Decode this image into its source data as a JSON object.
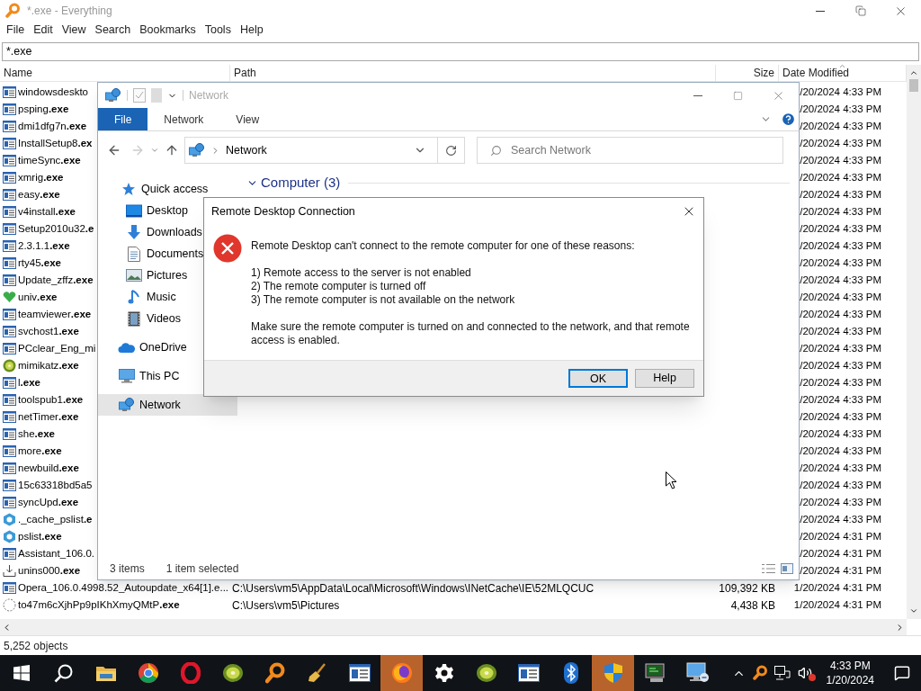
{
  "everything": {
    "title": "*.exe - Everything",
    "menu": [
      "File",
      "Edit",
      "View",
      "Search",
      "Bookmarks",
      "Tools",
      "Help"
    ],
    "search": {
      "value": "*.exe"
    },
    "columns": [
      {
        "label": "Name",
        "sorted": false
      },
      {
        "label": "Path",
        "sorted": false
      },
      {
        "label": "Size",
        "sorted": false
      },
      {
        "label": "Date Modified",
        "sorted": true
      }
    ],
    "rows": [
      {
        "kind": "app",
        "name": "windowsdeskto",
        "date": "/20/2024 4:33 PM"
      },
      {
        "kind": "app",
        "name": "psping**.exe**",
        "date": "/20/2024 4:33 PM"
      },
      {
        "kind": "app",
        "name": "dmi1dfg7n**.exe**",
        "date": "/20/2024 4:33 PM"
      },
      {
        "kind": "app",
        "name": "InstallSetup8**.ex**",
        "date": "/20/2024 4:33 PM"
      },
      {
        "kind": "app",
        "name": "timeSync**.exe**",
        "date": "/20/2024 4:33 PM"
      },
      {
        "kind": "app",
        "name": "xmrig**.exe**",
        "date": "/20/2024 4:33 PM"
      },
      {
        "kind": "app",
        "name": "easy**.exe**",
        "date": "/20/2024 4:33 PM"
      },
      {
        "kind": "app",
        "name": "v4install**.exe**",
        "date": "/20/2024 4:33 PM"
      },
      {
        "kind": "app",
        "name": "Setup2010u32**.e**",
        "date": "/20/2024 4:33 PM"
      },
      {
        "kind": "app",
        "name": "2.3.1.1**.exe**",
        "date": "/20/2024 4:33 PM"
      },
      {
        "kind": "app",
        "name": "rty45**.exe**",
        "date": "/20/2024 4:33 PM"
      },
      {
        "kind": "app",
        "name": "Update_zffz**.exe**",
        "date": "/20/2024 4:33 PM"
      },
      {
        "kind": "heart",
        "name": "univ**.exe**",
        "date": "/20/2024 4:33 PM"
      },
      {
        "kind": "app",
        "name": "teamviewer**.exe**",
        "date": "/20/2024 4:33 PM"
      },
      {
        "kind": "app",
        "name": "svchost1**.exe**",
        "date": "/20/2024 4:33 PM"
      },
      {
        "kind": "app",
        "name": "PCclear_Eng_mi",
        "date": "/20/2024 4:33 PM"
      },
      {
        "kind": "kiwi",
        "name": "mimikatz**.exe**",
        "date": "/20/2024 4:33 PM"
      },
      {
        "kind": "app",
        "name": "l**.exe**",
        "date": "/20/2024 4:33 PM"
      },
      {
        "kind": "app",
        "name": "toolspub1**.exe**",
        "date": "/20/2024 4:33 PM"
      },
      {
        "kind": "app",
        "name": "netTimer**.exe**",
        "date": "/20/2024 4:33 PM"
      },
      {
        "kind": "app",
        "name": "she**.exe**",
        "date": "/20/2024 4:33 PM"
      },
      {
        "kind": "app",
        "name": "more**.exe**",
        "date": "/20/2024 4:33 PM"
      },
      {
        "kind": "app",
        "name": "newbuild**.exe**",
        "date": "/20/2024 4:33 PM"
      },
      {
        "kind": "app",
        "name": "15c63318bd5a5",
        "date": "/20/2024 4:33 PM"
      },
      {
        "kind": "app",
        "name": "syncUpd**.exe**",
        "date": "/20/2024 4:33 PM"
      },
      {
        "kind": "hexagon",
        "name": "._cache_pslist**.e**",
        "date": "/20/2024 4:33 PM"
      },
      {
        "kind": "hexagon",
        "name": "pslist**.exe**",
        "date": "/20/2024 4:31 PM"
      },
      {
        "kind": "app",
        "name": "Assistant_106.0.",
        "date": "/20/2024 4:31 PM"
      },
      {
        "kind": "setup",
        "name": "unins000**.exe**",
        "date": "/20/2024 4:31 PM"
      },
      {
        "kind": "app",
        "name": "Opera_106.0.4998.52_Autoupdate_x64[1].e...",
        "path": "C:\\Users\\vm5\\AppData\\Local\\Microsoft\\Windows\\INetCache\\IE\\52MLQCUC",
        "size": "109,392 KB",
        "date": "1/20/2024 4:31 PM"
      },
      {
        "kind": "blank",
        "name": "to47m6cXjhPp9pIKhXmyQMtP**.exe**",
        "path": "C:\\Users\\vm5\\Pictures",
        "size": "4,438 KB",
        "date": "1/20/2024 4:31 PM"
      }
    ],
    "status": "5,252 objects"
  },
  "explorer": {
    "title": "Network",
    "tabs": [
      {
        "label": "File",
        "selected": true
      },
      {
        "label": "Network",
        "selected": false
      },
      {
        "label": "View",
        "selected": false
      }
    ],
    "address": "Network",
    "search": {
      "placeholder": "Search Network"
    },
    "nav": [
      {
        "kind": "star",
        "label": "Quick access",
        "selected": false
      },
      {
        "kind": "desktop",
        "label": "Desktop",
        "selected": false
      },
      {
        "kind": "downloads",
        "label": "Downloads",
        "selected": false
      },
      {
        "kind": "documents",
        "label": "Documents",
        "selected": false
      },
      {
        "kind": "pictures",
        "label": "Pictures",
        "selected": false
      },
      {
        "kind": "music",
        "label": "Music",
        "selected": false
      },
      {
        "kind": "videos",
        "label": "Videos",
        "selected": false
      },
      {
        "kind": "cloud",
        "label": "OneDrive",
        "selected": false
      },
      {
        "kind": "pc",
        "label": "This PC",
        "selected": false
      },
      {
        "kind": "network",
        "label": "Network",
        "selected": true
      }
    ],
    "group": "Computer (3)",
    "status": {
      "count": "3 items",
      "selection": "1 item selected"
    }
  },
  "dialog": {
    "title": "Remote Desktop Connection",
    "intro": "Remote Desktop can't connect to the remote computer for one of these reasons:",
    "reasons": [
      "1) Remote access to the server is not enabled",
      "2) The remote computer is turned off",
      "3) The remote computer is not available on the network"
    ],
    "advice": "Make sure the remote computer is turned on and connected to the network, and that remote access is enabled.",
    "buttons": [
      {
        "label": "OK",
        "selected": true
      },
      {
        "label": "Help",
        "selected": false
      }
    ]
  },
  "taskbar": {
    "buttons": [
      {
        "kind": "start",
        "active": false
      },
      {
        "kind": "search",
        "active": false
      },
      {
        "kind": "folder",
        "active": false
      },
      {
        "kind": "chrome",
        "active": false
      },
      {
        "kind": "ring",
        "active": false
      },
      {
        "kind": "kiwi",
        "active": false
      },
      {
        "kind": "magnifier",
        "active": false
      },
      {
        "kind": "broom",
        "active": false
      },
      {
        "kind": "window",
        "active": false
      },
      {
        "kind": "globe",
        "active": true
      },
      {
        "kind": "gear",
        "active": false
      },
      {
        "kind": "kiwi",
        "active": false
      },
      {
        "kind": "window",
        "active": false
      },
      {
        "kind": "bluetooth",
        "active": false
      },
      {
        "kind": "shield",
        "active": true
      },
      {
        "kind": "terminal",
        "active": false
      },
      {
        "kind": "monitor",
        "active": false
      }
    ],
    "time": "4:33 PM",
    "date": "1/20/2024"
  }
}
